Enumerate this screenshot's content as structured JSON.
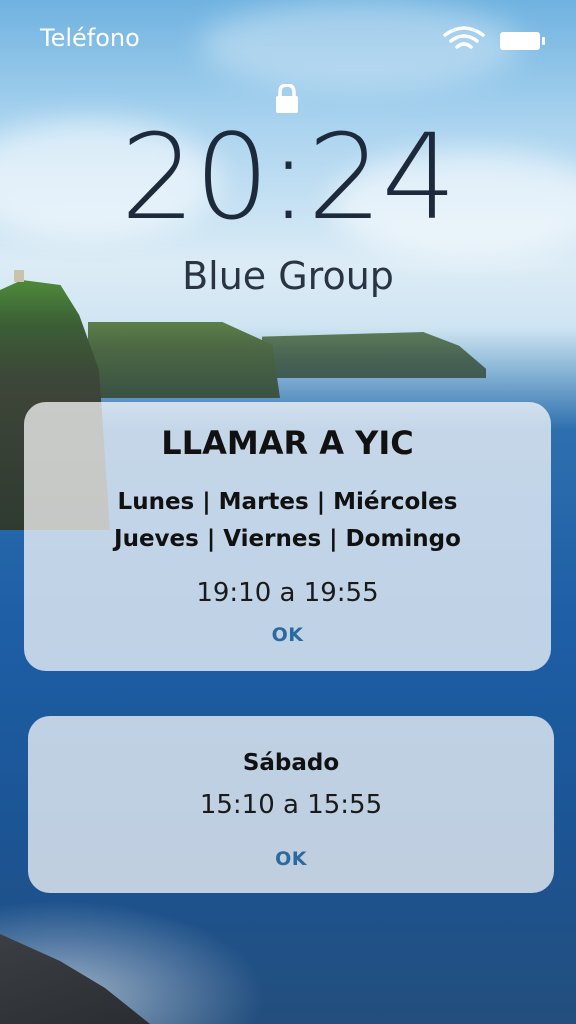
{
  "status_bar": {
    "carrier": "Teléfono",
    "icons": [
      "wifi-icon",
      "battery-icon"
    ]
  },
  "lock_screen": {
    "lock_icon": "lock-icon",
    "time": "20:24",
    "owner": "Blue Group"
  },
  "notifications": [
    {
      "title": "LLAMAR A YIC",
      "days_line1": "Lunes | Martes | Miércoles",
      "days_line2": "Jueves | Viernes | Domingo",
      "time": "19:10 a 19:55",
      "action": "OK"
    },
    {
      "title": "Sábado",
      "time": "15:10 a 15:55",
      "action": "OK"
    }
  ],
  "colors": {
    "clock_text": "#1d2a3c",
    "ok_text": "#2a6a9e",
    "card_bg": "rgba(255,255,255,0.72)"
  }
}
